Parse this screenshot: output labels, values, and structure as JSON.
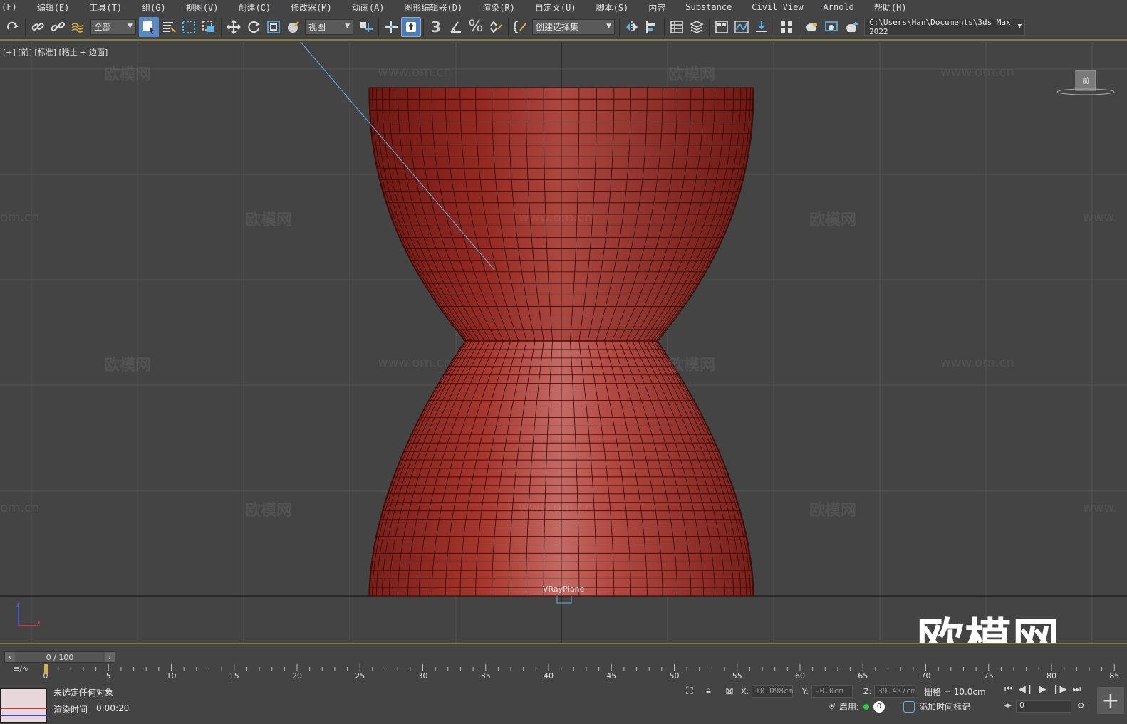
{
  "menu": [
    "(F)",
    "编辑(E)",
    "工具(T)",
    "组(G)",
    "视图(V)",
    "创建(C)",
    "修改器(M)",
    "动画(A)",
    "图形编辑器(D)",
    "渲染(R)",
    "自定义(U)",
    "脚本(S)",
    "内容",
    "Substance",
    "Civil View",
    "Arnold",
    "帮助(H)"
  ],
  "toolbar": {
    "filter_selected": "全部",
    "refcoord_selected": "视图",
    "named_selection_placeholder": "创建选择集",
    "path": "C:\\Users\\Han\\Documents\\3ds Max 2022"
  },
  "viewport": {
    "label": "[+] [前] [标准] [粘土 + 边面]",
    "object_label": "VRayPlane",
    "viewcube_face": "前",
    "watermark_brand": "欧模网",
    "watermark_url": "www.om.cn",
    "watermark_url_partial": "om.cn",
    "watermark_url_edge": "www.",
    "big_watermark": "欧模网",
    "vase_color": "#a2332b",
    "selection_color": "#5ab4ea"
  },
  "timeline": {
    "frame_display": "0 / 100",
    "ticks": [
      "0",
      "5",
      "10",
      "15",
      "20",
      "25",
      "30",
      "35",
      "40",
      "45",
      "50",
      "55",
      "60",
      "65",
      "70",
      "75",
      "80",
      "85"
    ]
  },
  "status": {
    "selection": "未选定任何对象",
    "render_time_label": "渲染时间",
    "render_time_value": "0:00:20",
    "x_label": "X:",
    "x_value": "10.098cm",
    "y_label": "Y:",
    "y_value": "-0.0cm",
    "z_label": "Z:",
    "z_value": "39.457cm",
    "grid": "栅格 = 10.0cm",
    "enable_label": "启用:",
    "enable_count": "0",
    "add_time_tag": "添加时间标记",
    "current_frame": "0"
  }
}
